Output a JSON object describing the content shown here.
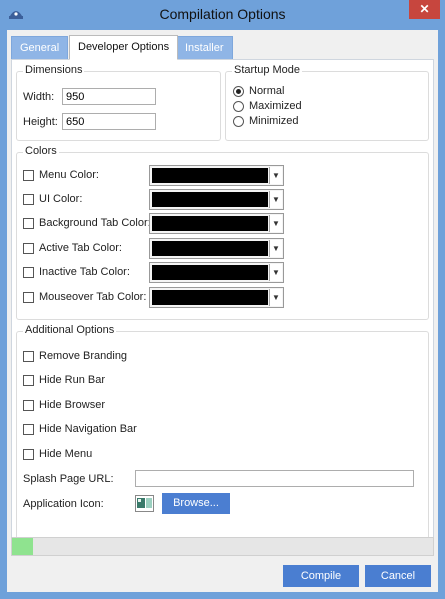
{
  "window": {
    "title": "Compilation Options",
    "close_glyph": "✕"
  },
  "tabs": [
    {
      "label": "General",
      "active": false
    },
    {
      "label": "Developer Options",
      "active": true
    },
    {
      "label": "Installer",
      "active": false
    }
  ],
  "dimensions": {
    "title": "Dimensions",
    "width_label": "Width:",
    "width_value": "950",
    "height_label": "Height:",
    "height_value": "650"
  },
  "startup_mode": {
    "title": "Startup Mode",
    "options": [
      {
        "label": "Normal",
        "selected": true
      },
      {
        "label": "Maximized",
        "selected": false
      },
      {
        "label": "Minimized",
        "selected": false
      }
    ]
  },
  "colors": {
    "title": "Colors",
    "items": [
      {
        "label": "Menu Color:",
        "checked": false,
        "color": "#000000"
      },
      {
        "label": "UI Color:",
        "checked": false,
        "color": "#000000"
      },
      {
        "label": "Background Tab Color:",
        "checked": false,
        "color": "#000000"
      },
      {
        "label": "Active Tab Color:",
        "checked": false,
        "color": "#000000"
      },
      {
        "label": "Inactive Tab Color:",
        "checked": false,
        "color": "#000000"
      },
      {
        "label": "Mouseover Tab Color:",
        "checked": false,
        "color": "#000000"
      }
    ],
    "dropdown_glyph": "▼"
  },
  "additional": {
    "title": "Additional Options",
    "items": [
      {
        "label": "Remove Branding",
        "checked": false
      },
      {
        "label": "Hide Run Bar",
        "checked": false
      },
      {
        "label": "Hide Browser",
        "checked": false
      },
      {
        "label": "Hide Navigation Bar",
        "checked": false
      },
      {
        "label": "Hide Menu",
        "checked": false
      }
    ],
    "splash_label": "Splash Page URL:",
    "splash_value": "",
    "app_icon_label": "Application Icon:",
    "browse_label": "Browse..."
  },
  "progress": {
    "value_percent": 5
  },
  "footer": {
    "compile_label": "Compile",
    "cancel_label": "Cancel"
  },
  "theme": {
    "frame": "#6fa1da",
    "accent_button": "#4a7ed1",
    "close_button": "#c7463e",
    "progress_fill": "#8fe38f"
  },
  "icons": [
    "app-icon",
    "close-icon",
    "radio-icon",
    "checkbox-icon",
    "dropdown-arrow-icon",
    "app-icon-thumbnail"
  ]
}
